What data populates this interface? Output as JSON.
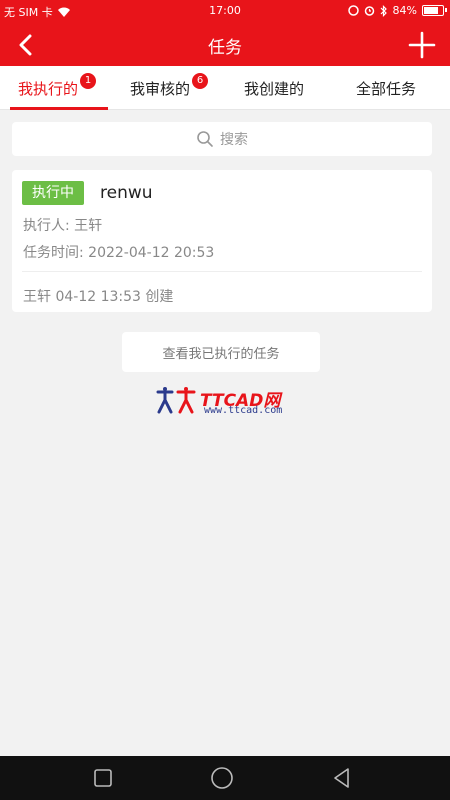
{
  "status_bar": {
    "carrier": "无 SIM 卡",
    "time": "17:00",
    "battery_text": "84%",
    "battery_level": 0.84
  },
  "nav": {
    "title": "任务",
    "back_icon": "chevron-left-icon",
    "add_icon": "plus-icon"
  },
  "tabs": [
    {
      "label": "我执行的",
      "badge": "1",
      "active": true
    },
    {
      "label": "我审核的",
      "badge": "6",
      "active": false
    },
    {
      "label": "我创建的",
      "badge": "",
      "active": false
    },
    {
      "label": "全部任务",
      "badge": "",
      "active": false
    }
  ],
  "search": {
    "placeholder": "搜索",
    "icon": "search-icon"
  },
  "task_card": {
    "status": "执行中",
    "title": "renwu",
    "executor": "执行人: 王轩",
    "time": "任务时间: 2022-04-12 20:53",
    "created": "王轩 04-12 13:53 创建"
  },
  "view_button": "查看我已执行的任务",
  "watermark": {
    "logo": "TTCAD网",
    "url": "www.ttcad.com"
  },
  "colors": {
    "brand_red": "#e8141a",
    "status_green": "#6cbe45"
  }
}
